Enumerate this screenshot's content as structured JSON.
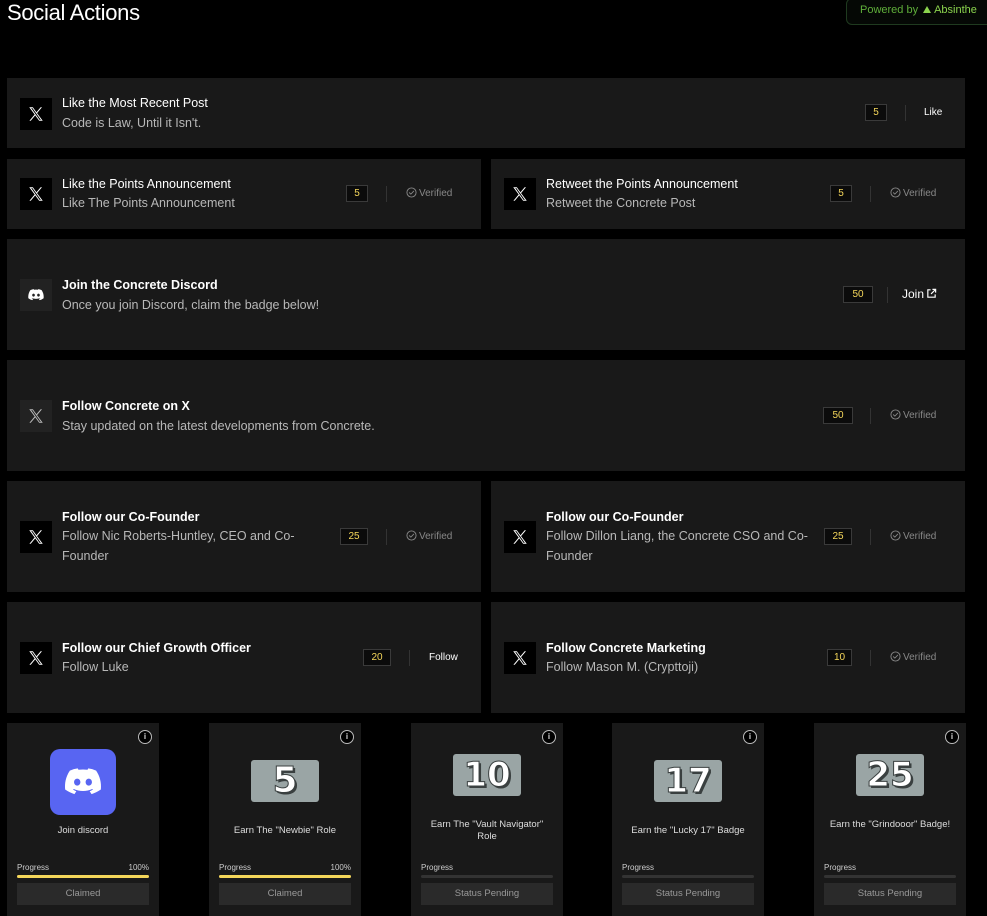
{
  "header": {
    "title": "Social Actions",
    "powered_by": "Powered by",
    "brand": "Absinthe"
  },
  "actions": [
    {
      "title": "Like the Most Recent Post",
      "subtitle": "Code is Law, Until it Isn't.",
      "points": "5",
      "action": "Like"
    },
    {
      "title": "Like the Points Announcement",
      "subtitle": "Like The Points Announcement",
      "points": "5",
      "status": "Verified"
    },
    {
      "title": "Retweet the Points Announcement",
      "subtitle": "Retweet the Concrete Post",
      "points": "5",
      "status": "Verified"
    },
    {
      "title": "Join the Concrete Discord",
      "subtitle": "Once you join Discord, claim the badge below!",
      "points": "50",
      "action": "Join"
    },
    {
      "title": "Follow Concrete on X",
      "subtitle": "Stay updated on the latest developments from Concrete.",
      "points": "50",
      "status": "Verified"
    },
    {
      "title": "Follow our Co-Founder",
      "subtitle": "Follow Nic Roberts-Huntley, CEO and Co-Founder",
      "points": "25",
      "status": "Verified"
    },
    {
      "title": "Follow our Co-Founder",
      "subtitle": "Follow Dillon Liang, the Concrete CSO and Co-Founder",
      "points": "25",
      "status": "Verified"
    },
    {
      "title": "Follow our Chief Growth Officer",
      "subtitle": "Follow Luke",
      "points": "20",
      "action": "Follow"
    },
    {
      "title": "Follow Concrete Marketing",
      "subtitle": "Follow Mason M. (Crypttoji)",
      "points": "10",
      "status": "Verified"
    }
  ],
  "badges": [
    {
      "label": "Join discord",
      "progress_label": "Progress",
      "percent": "100%",
      "progress": 1.0,
      "button": "Claimed"
    },
    {
      "number": "5",
      "label": "Earn The \"Newbie\" Role",
      "progress_label": "Progress",
      "percent": "100%",
      "progress": 1.0,
      "button": "Claimed"
    },
    {
      "number": "10",
      "label": "Earn The \"Vault Navigator\" Role",
      "progress_label": "Progress",
      "progress": 0,
      "button": "Status Pending"
    },
    {
      "number": "17",
      "label": "Earn the \"Lucky 17\" Badge",
      "progress_label": "Progress",
      "progress": 0,
      "button": "Status Pending"
    },
    {
      "number": "25",
      "label": "Earn the \"Grindooor\" Badge!",
      "progress_label": "Progress",
      "progress": 0,
      "button": "Status Pending"
    }
  ],
  "info_glyph": "i",
  "colors": {
    "points_text": "#f4d65a",
    "card_bg": "#191919",
    "discord": "#5865f2",
    "brand_green": "#8bd44e"
  }
}
